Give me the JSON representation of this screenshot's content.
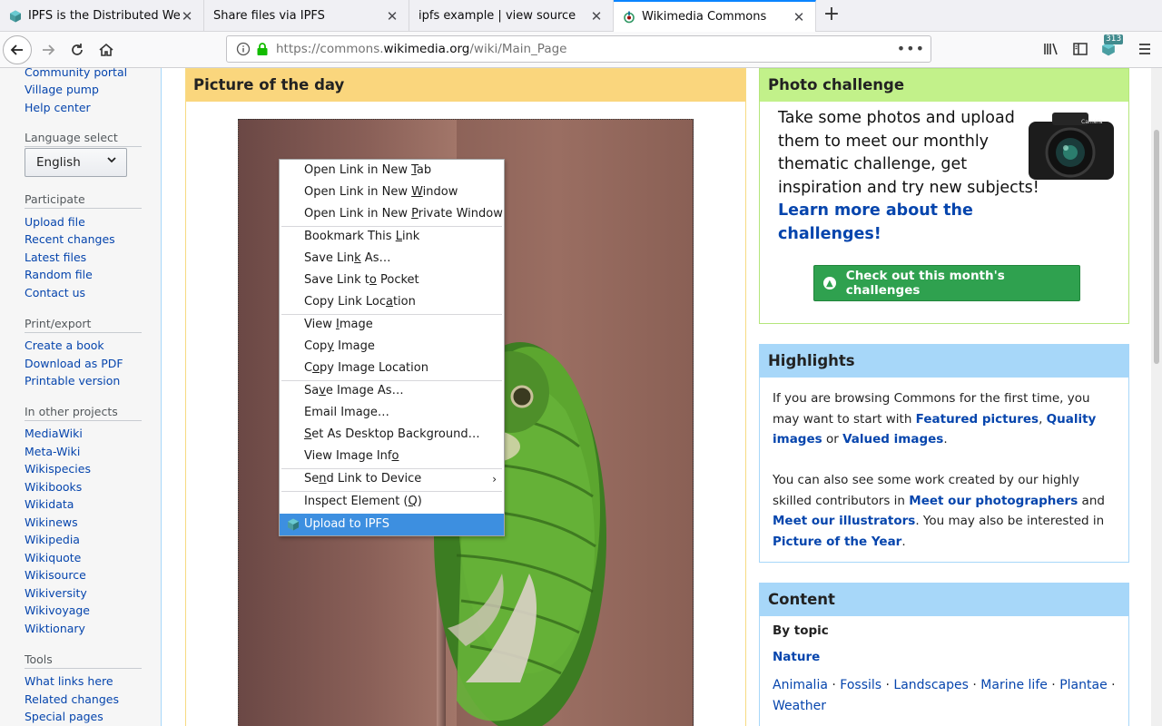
{
  "tabs": [
    {
      "title": "IPFS is the Distributed Web",
      "icon": "ipfs-cube-icon"
    },
    {
      "title": "Share files via IPFS",
      "icon": ""
    },
    {
      "title": "ipfs example | view source",
      "icon": ""
    },
    {
      "title": "Wikimedia Commons",
      "icon": "wikimedia-icon",
      "active": true
    }
  ],
  "url": {
    "prefix": "https://commons.",
    "host": "wikimedia.org",
    "path": "/wiki/Main_Page"
  },
  "toolbar": {
    "ipfs_badge": "313"
  },
  "sidebar": {
    "top_links": [
      "Community portal",
      "Village pump",
      "Help center"
    ],
    "language_heading": "Language select",
    "language_value": "English",
    "participate_heading": "Participate",
    "participate_links": [
      "Upload file",
      "Recent changes",
      "Latest files",
      "Random file",
      "Contact us"
    ],
    "print_heading": "Print/export",
    "print_links": [
      "Create a book",
      "Download as PDF",
      "Printable version"
    ],
    "projects_heading": "In other projects",
    "projects_links": [
      "MediaWiki",
      "Meta-Wiki",
      "Wikispecies",
      "Wikibooks",
      "Wikidata",
      "Wikinews",
      "Wikipedia",
      "Wikiquote",
      "Wikisource",
      "Wikiversity",
      "Wikivoyage",
      "Wiktionary"
    ],
    "tools_heading": "Tools",
    "tools_links": [
      "What links here",
      "Related changes",
      "Special pages"
    ]
  },
  "potd": {
    "heading": "Picture of the day"
  },
  "photo_challenge": {
    "heading": "Photo challenge",
    "text": "Take some photos and upload them to meet our monthly thematic challenge, get inspiration and try new subjects! ",
    "link": "Learn more about the challenges!",
    "button": "Check out this month's challenges",
    "camera_label": "Camera"
  },
  "highlights": {
    "heading": "Highlights",
    "p1_a": "If you are browsing Commons for the first time, you may want to start with ",
    "featured": "Featured pictures",
    "comma": ", ",
    "quality": "Quality images",
    "or": " or ",
    "valued": "Valued images",
    "period": ".",
    "p2_a": "You can also see some work created by our highly skilled contributors in ",
    "photographers": "Meet our photographers",
    "and": " and ",
    "illustrators": "Meet our illustrators",
    "p2_b": ". You may also be interested in ",
    "poty": "Picture of the Year",
    "p2_end": "."
  },
  "content_box": {
    "heading": "Content",
    "by_topic": "By topic",
    "nature": "Nature",
    "topics": [
      "Animalia",
      "Fossils",
      "Landscapes",
      "Marine life",
      "Plantae",
      "Weather"
    ],
    "separator": " · "
  },
  "context_menu": [
    {
      "pre": "Open Link in New ",
      "key": "T",
      "post": "ab"
    },
    {
      "pre": "Open Link in New ",
      "key": "W",
      "post": "indow"
    },
    {
      "pre": "Open Link in New ",
      "key": "P",
      "post": "rivate Window"
    },
    {
      "pre": "Bookmark This ",
      "key": "L",
      "post": "ink"
    },
    {
      "pre": "Save Lin",
      "key": "k",
      "post": " As…"
    },
    {
      "pre": "Save Link t",
      "key": "o",
      "post": " Pocket"
    },
    {
      "pre": "Copy Link Loc",
      "key": "a",
      "post": "tion"
    },
    {
      "pre": "View ",
      "key": "I",
      "post": "mage"
    },
    {
      "pre": "Cop",
      "key": "y",
      "post": " Image"
    },
    {
      "pre": "C",
      "key": "o",
      "post": "py Image Location"
    },
    {
      "pre": "Sa",
      "key": "v",
      "post": "e Image As…"
    },
    {
      "pre": "Email Image",
      "key": "",
      "post": "…"
    },
    {
      "pre": "",
      "key": "S",
      "post": "et As Desktop Background…"
    },
    {
      "pre": "View Image Inf",
      "key": "o",
      "post": ""
    },
    {
      "pre": "Se",
      "key": "n",
      "post": "d Link to Device"
    },
    {
      "pre": "Inspect Element (",
      "key": "Q",
      "post": ")"
    },
    {
      "pre": "Upload to IPFS",
      "key": "",
      "post": ""
    }
  ]
}
